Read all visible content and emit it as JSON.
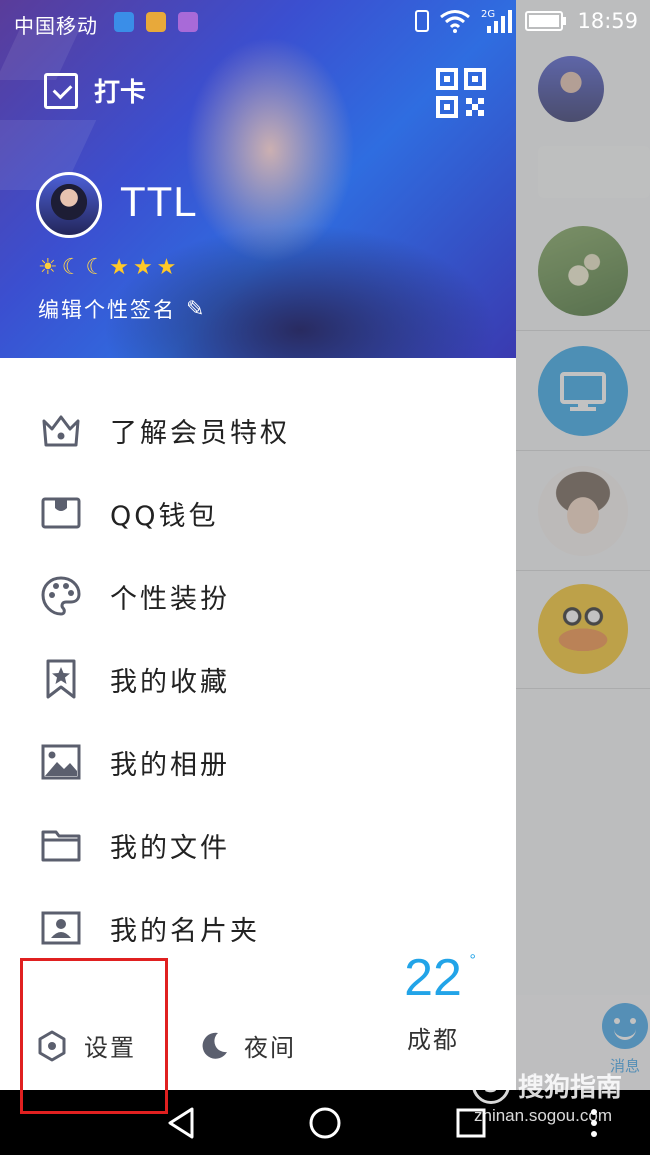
{
  "status_bar": {
    "carrier": "中国移动",
    "network_type": "2G",
    "time": "18:59"
  },
  "header": {
    "checkin_label": "打卡",
    "username": "TTL",
    "level_icons": [
      "sun-icon",
      "moon-icon",
      "moon-icon",
      "star-icon",
      "star-icon",
      "star-icon"
    ],
    "signature": "编辑个性签名"
  },
  "menu": {
    "items": [
      {
        "label": "了解会员特权",
        "icon": "crown-icon"
      },
      {
        "label": "QQ钱包",
        "icon": "wallet-icon"
      },
      {
        "label": "个性装扮",
        "icon": "palette-icon"
      },
      {
        "label": "我的收藏",
        "icon": "bookmark-star-icon"
      },
      {
        "label": "我的相册",
        "icon": "album-icon"
      },
      {
        "label": "我的文件",
        "icon": "folder-icon"
      },
      {
        "label": "我的名片夹",
        "icon": "contact-card-icon"
      }
    ]
  },
  "bottom": {
    "settings_label": "设置",
    "night_label": "夜间",
    "temperature": "22",
    "degree_symbol": "°",
    "city": "成都"
  },
  "background": {
    "message_tab_label": "消息"
  },
  "watermark": {
    "brand": "搜狗指南",
    "url": "zhinan.sogou.com"
  },
  "colors": {
    "accent_blue": "#22a4e8",
    "highlight_red": "#e02020",
    "icon_gray": "#5b5f6e"
  }
}
